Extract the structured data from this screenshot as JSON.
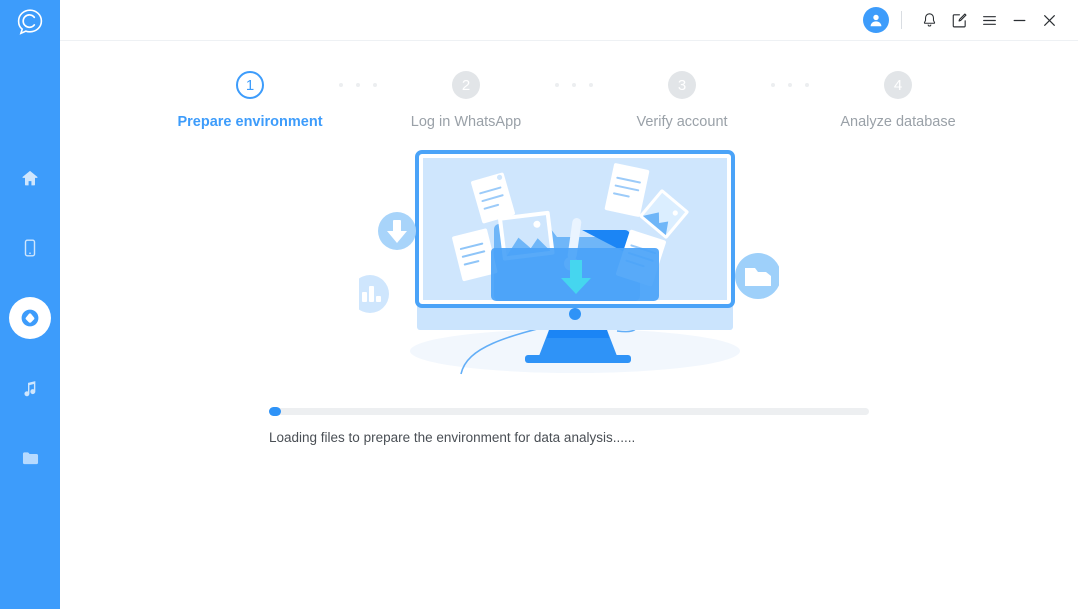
{
  "app": {
    "logo_icon": "chat-bubble-c-logo",
    "accent_color": "#3d9cfb",
    "sidebar_color": "#3d9cfb",
    "inactive_step_color": "#e2e5e8",
    "inactive_text_color": "#9aa1a8"
  },
  "sidebar": {
    "items": [
      {
        "name": "home",
        "icon": "home-icon",
        "active": false
      },
      {
        "name": "phone",
        "icon": "mobile-phone-icon",
        "active": false
      },
      {
        "name": "recover",
        "icon": "droplet-circle-icon",
        "active": true
      },
      {
        "name": "music",
        "icon": "music-note-icon",
        "active": false
      },
      {
        "name": "files",
        "icon": "folder-icon",
        "active": false
      }
    ]
  },
  "titlebar": {
    "avatar_icon": "user-avatar-icon",
    "buttons": [
      {
        "name": "notifications",
        "icon": "bell-icon"
      },
      {
        "name": "feedback",
        "icon": "edit-note-icon"
      },
      {
        "name": "menu",
        "icon": "hamburger-menu-icon"
      },
      {
        "name": "minimize",
        "icon": "minimize-icon"
      },
      {
        "name": "close",
        "icon": "close-icon"
      }
    ]
  },
  "stepper": {
    "steps": [
      {
        "number": "1",
        "label": "Prepare environment",
        "state": "active"
      },
      {
        "number": "2",
        "label": "Log in WhatsApp",
        "state": "inactive"
      },
      {
        "number": "3",
        "label": "Verify account",
        "state": "inactive"
      },
      {
        "number": "4",
        "label": "Analyze database",
        "state": "inactive"
      }
    ]
  },
  "illustration": {
    "name": "desktop-monitor-file-transfer-illustration",
    "badges": [
      {
        "name": "download-badge",
        "icon": "download-arrow-icon"
      },
      {
        "name": "chart-badge",
        "icon": "bar-chart-icon"
      },
      {
        "name": "media-badge",
        "icon": "video-folder-icon"
      }
    ]
  },
  "progress": {
    "percent": 1,
    "status_text": "Loading files to prepare the environment for data analysis......"
  }
}
